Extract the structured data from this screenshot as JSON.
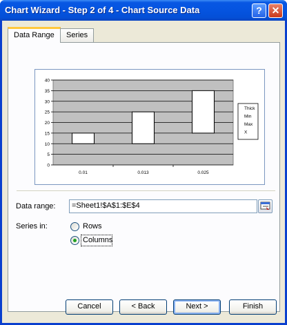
{
  "window": {
    "title": "Chart Wizard - Step 2 of 4 - Chart Source Data",
    "help_icon": "?",
    "close_icon": "✕"
  },
  "tabs": [
    {
      "label": "Data Range",
      "active": true
    },
    {
      "label": "Series",
      "active": false
    }
  ],
  "chart_data": {
    "type": "candlestick",
    "categories": [
      "0.01",
      "0.013",
      "0.025"
    ],
    "series": [
      {
        "name": "Thick",
        "values": [
          null,
          null,
          null
        ]
      },
      {
        "name": "Min",
        "values": [
          10,
          10,
          15
        ]
      },
      {
        "name": "Max",
        "values": [
          15,
          25,
          35
        ]
      },
      {
        "name": "X",
        "values": [
          null,
          null,
          null
        ]
      }
    ],
    "ylim": [
      0,
      40
    ],
    "yticks": [
      "0",
      "5",
      "10",
      "15",
      "20",
      "25",
      "30",
      "35",
      "40"
    ],
    "legend_placement": "right",
    "grid": true,
    "plot_bg_color": "#c0c0c0",
    "box_color": "#ffffff"
  },
  "form": {
    "data_range_label": "Data range:",
    "data_range_value": "=Sheet1!$A$1:$E$4",
    "series_in_label": "Series in:",
    "rows_label": "Rows",
    "columns_label": "Columns",
    "selected": "Columns"
  },
  "buttons": {
    "cancel": "Cancel",
    "back": "< Back",
    "next": "Next >",
    "finish": "Finish"
  }
}
